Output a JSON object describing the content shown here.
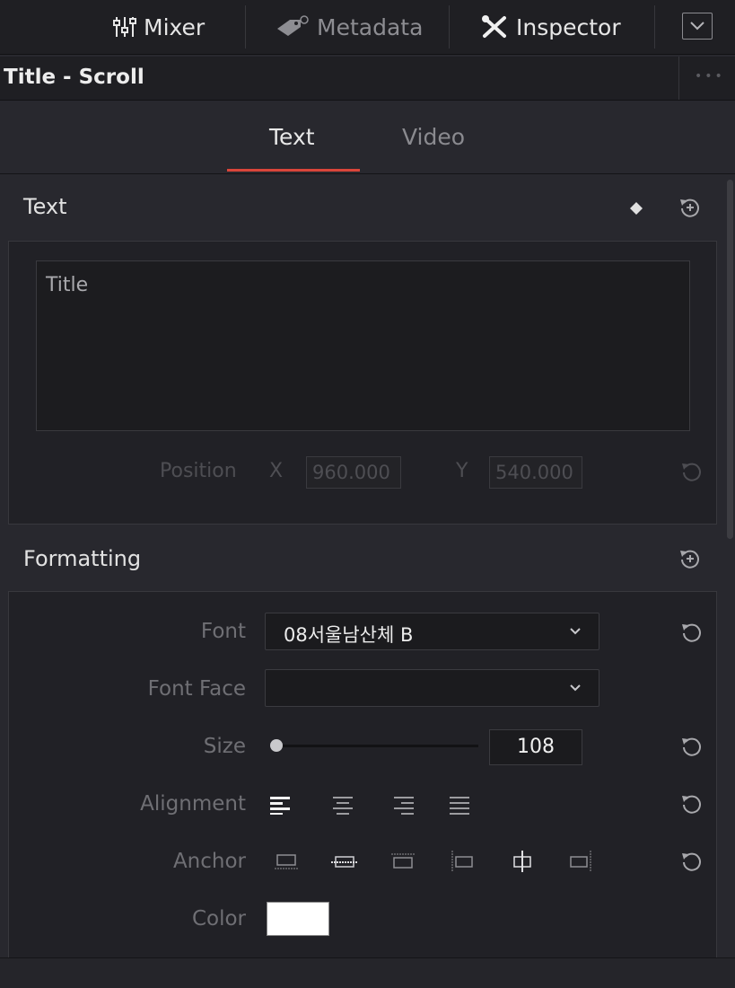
{
  "topbar": {
    "mixer_label": "Mixer",
    "metadata_label": "Metadata",
    "inspector_label": "Inspector"
  },
  "title": "Title - Scroll",
  "tabs": [
    {
      "label": "Text",
      "active": true
    },
    {
      "label": "Video",
      "active": false
    }
  ],
  "text_section": {
    "header": "Text",
    "text_value": "Title",
    "position_label": "Position",
    "x_label": "X",
    "x_value": "960.000",
    "y_label": "Y",
    "y_value": "540.000"
  },
  "formatting": {
    "header": "Formatting",
    "font_label": "Font",
    "font_value": "08서울남산체 B",
    "font_face_label": "Font Face",
    "font_face_value": "",
    "size_label": "Size",
    "size_value": "108",
    "size_slider_fraction": 0.02,
    "alignment_label": "Alignment",
    "anchor_label": "Anchor",
    "color_label": "Color",
    "color_value": "#ffffff"
  },
  "accent_color": "#d9453a",
  "icons": [
    "mixer-icon",
    "metadata-icon",
    "inspector-icon",
    "panel-toggle-icon",
    "keyframe-diamond-icon",
    "reset-icon",
    "chevron-down-icon",
    "align-left-icon",
    "align-center-icon",
    "align-right-icon",
    "align-justify-icon",
    "anchor-icon"
  ]
}
